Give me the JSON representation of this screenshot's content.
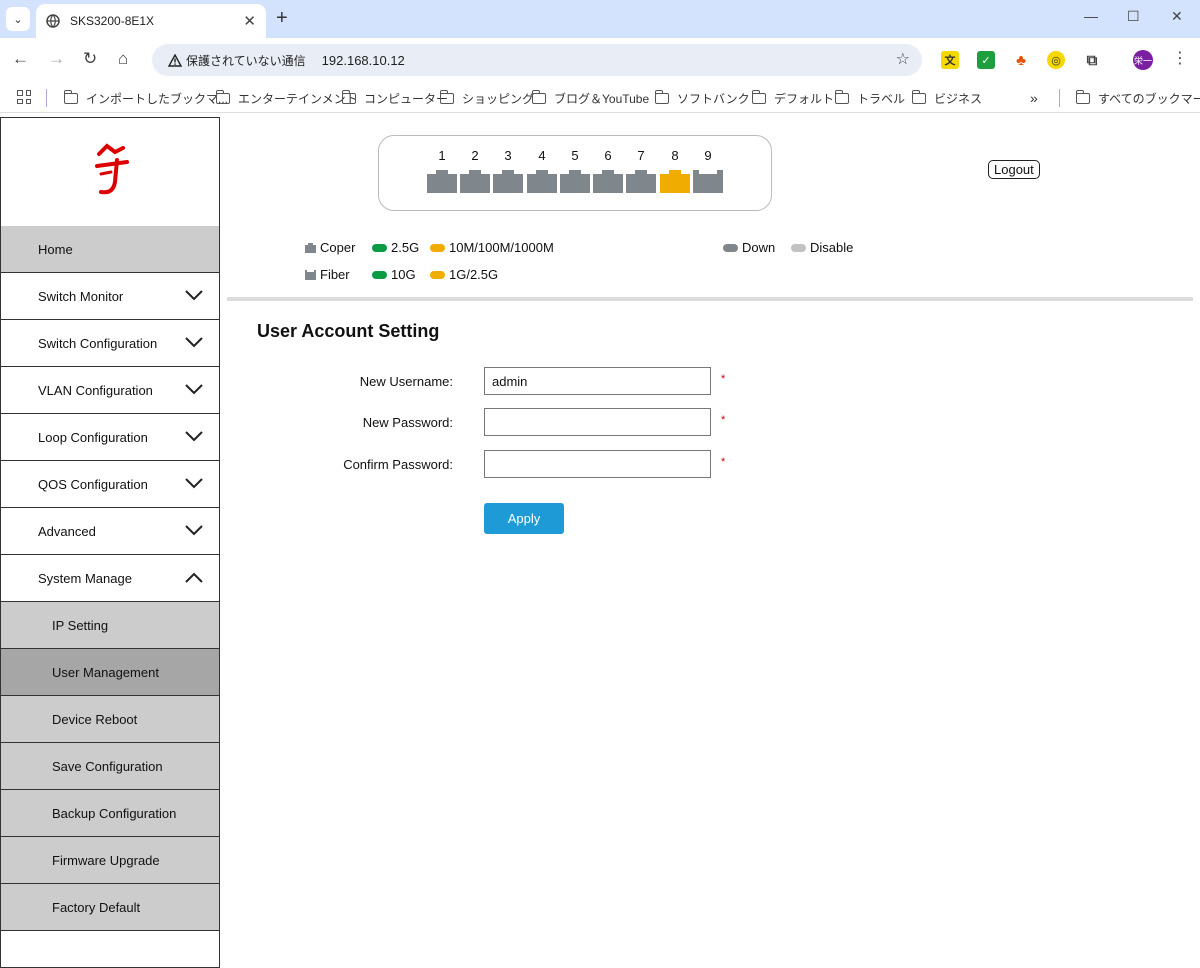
{
  "browser": {
    "tab_title": "SKS3200-8E1X",
    "security_label": "保護されていない通信",
    "url": "192.168.10.12",
    "profile_initials": "栄一",
    "bookmarks": [
      "インポートしたブックマ...",
      "エンターテインメント",
      "コンピューター",
      "ショッピング",
      "ブログ＆YouTube",
      "ソフトバンク",
      "デフォルト",
      "トラベル",
      "ビジネス"
    ],
    "bookmarks_overflow": "»",
    "all_bookmarks": "すべてのブックマーク"
  },
  "sidebar": {
    "home": "Home",
    "sections": [
      {
        "label": "Switch Monitor"
      },
      {
        "label": "Switch Configuration"
      },
      {
        "label": "VLAN Configuration"
      },
      {
        "label": "Loop Configuration"
      },
      {
        "label": "QOS Configuration"
      },
      {
        "label": "Advanced"
      },
      {
        "label": "System Manage"
      }
    ],
    "system_manage_items": [
      {
        "label": "IP Setting"
      },
      {
        "label": "User Management"
      },
      {
        "label": "Device Reboot"
      },
      {
        "label": "Save Configuration"
      },
      {
        "label": "Backup Configuration"
      },
      {
        "label": "Firmware Upgrade"
      },
      {
        "label": "Factory Default"
      }
    ]
  },
  "ports": {
    "labels": [
      "1",
      "2",
      "3",
      "4",
      "5",
      "6",
      "7",
      "8",
      "9"
    ],
    "states": [
      "down",
      "down",
      "down",
      "down",
      "down",
      "down",
      "down",
      "up-1g",
      "fiber-down"
    ]
  },
  "logout_label": "Logout",
  "legend": {
    "coper": "Coper",
    "fiber": "Fiber",
    "c_25g": "2.5G",
    "c_10m": "10M/100M/1000M",
    "f_10g": "10G",
    "f_1g": "1G/2.5G",
    "down": "Down",
    "disable": "Disable"
  },
  "colors": {
    "port_down": "#7f868c",
    "port_amber": "#f0ad00",
    "port_green": "#0a9b45",
    "disable": "#c2c2c2",
    "apply_button": "#1e9bd7"
  },
  "form": {
    "title": "User Account Setting",
    "username_label": "New Username:",
    "username_value": "admin",
    "password_label": "New Password:",
    "password_value": "",
    "confirm_label": "Confirm Password:",
    "confirm_value": "",
    "required_mark": "*",
    "apply_label": "Apply"
  }
}
